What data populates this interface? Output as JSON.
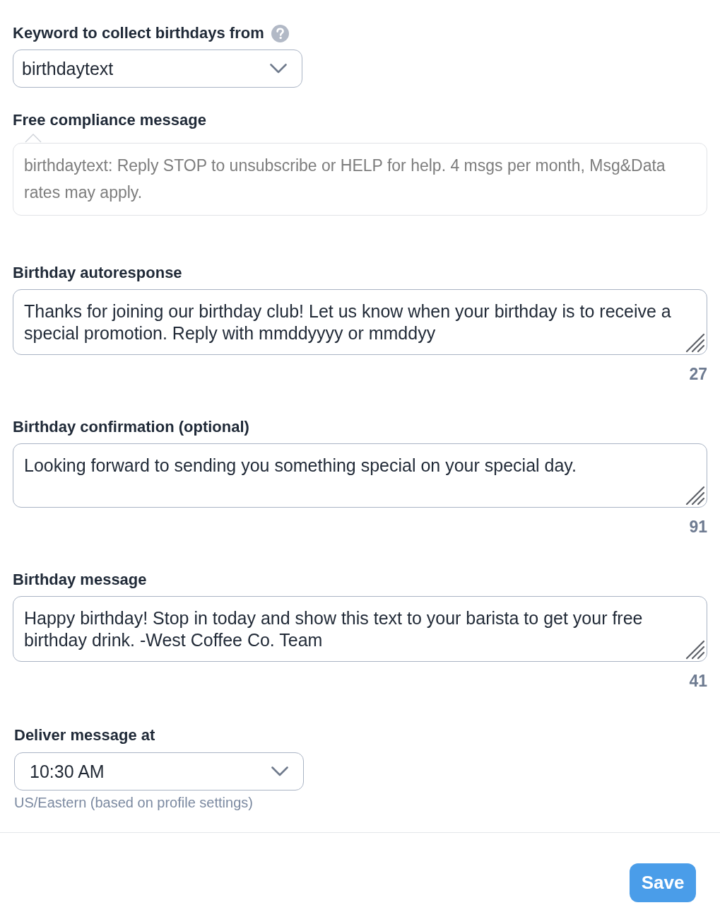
{
  "keyword": {
    "label": "Keyword to collect birthdays from",
    "value": "birthdaytext"
  },
  "compliance": {
    "label": "Free compliance message",
    "text": "birthdaytext: Reply STOP to unsubscribe or HELP for help. 4 msgs per month, Msg&Data rates may apply."
  },
  "messages": [
    {
      "label": "Birthday autoresponse",
      "value": "Thanks for joining our birthday club! Let us know when your birthday is to receive a special promotion. Reply with mmddyyyy or mmddyy",
      "count": "27"
    },
    {
      "label": "Birthday confirmation (optional)",
      "value": "Looking forward to sending you something special on your special day.",
      "count": "91"
    },
    {
      "label": "Birthday message",
      "value": "Happy birthday! Stop in today and show this text to your barista to get your free birthday drink. -West Coffee Co. Team",
      "count": "41"
    }
  ],
  "delivery": {
    "label": "Deliver message at",
    "value": "10:30 AM",
    "hint": "US/Eastern (based on profile settings)"
  },
  "buttons": [
    {
      "label": "Save"
    }
  ]
}
